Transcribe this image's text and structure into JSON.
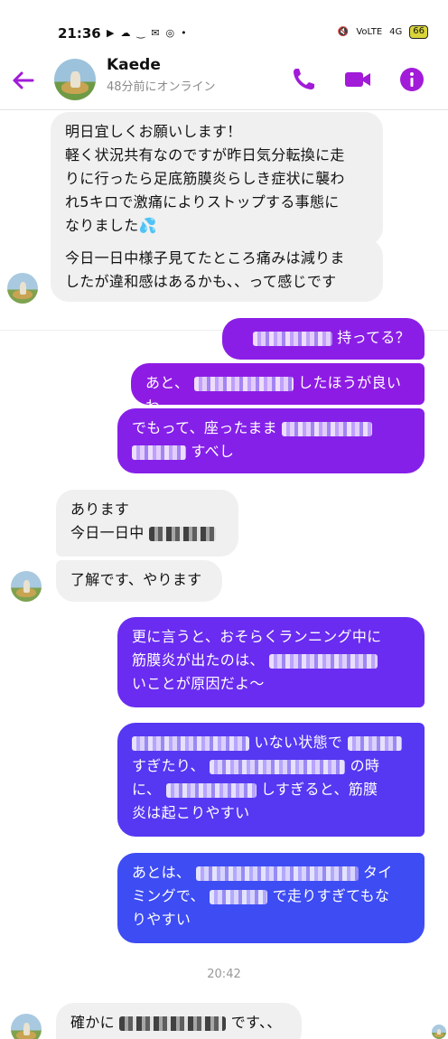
{
  "status_bar": {
    "time": "21:36",
    "battery": "66",
    "network": "4G"
  },
  "header": {
    "name": "Kaede",
    "status": "48分前にオンライン"
  },
  "messages": [
    {
      "side": "in",
      "lines": [
        "明日宜しくお願いします！",
        "軽く状況共有なのですが昨日気分転換に走",
        "りに行ったら足底筋膜炎らしき症状に襲わ",
        "れ5キロで激痛によりストップする事態に",
        "なりました💦"
      ]
    },
    {
      "side": "in",
      "lines": [
        "今日一日中様子見てたところ痛みは減りま",
        "したが違和感はあるかも、、って感じです"
      ]
    },
    {
      "side": "out",
      "text": "持ってる？"
    },
    {
      "side": "out",
      "text_a": "あと、",
      "text_b": "したほうが良いわ"
    },
    {
      "side": "out",
      "text_a": "でもって、座ったまま",
      "text_b": "すべし"
    },
    {
      "side": "in",
      "line1": "あります",
      "line2": "今日一日中"
    },
    {
      "side": "in",
      "text": "了解です、やります"
    },
    {
      "side": "out",
      "line1": "更に言うと、おそらくランニング中に",
      "line2": "筋膜炎が出たのは、",
      "line3": "いことが原因だよ〜"
    },
    {
      "side": "out",
      "line1": "いない状態で",
      "line2a": "すぎたり、",
      "line2b": "の時",
      "line3a": "に、",
      "line3b": "しすぎると、筋膜",
      "line4": "炎は起こりやすい"
    },
    {
      "side": "out",
      "line1a": "あとは、",
      "line1b": "タイ",
      "line2a": "ミングで、",
      "line2b": "で走りすぎてもな",
      "line3": "りやすい"
    },
    {
      "side": "in",
      "text_a": "確かに",
      "text_b": "です、、"
    }
  ],
  "timestamp": "20:42",
  "colors": {
    "accent": "#a11bd8",
    "bubble_purple": "#8b1ee6",
    "bubble_violet": "#6a2cf0",
    "bubble_blue": "#3d4cf3",
    "bubble_in": "#f0f0f0"
  }
}
